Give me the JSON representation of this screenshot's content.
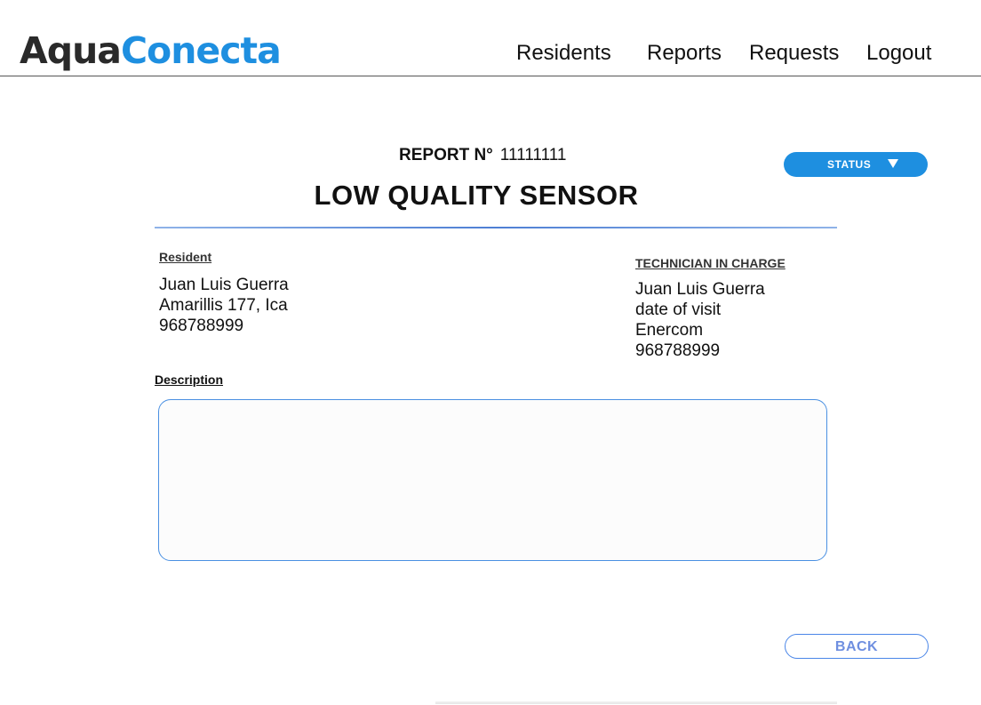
{
  "brand": {
    "name_part1": "Aqua",
    "name_part2": "Conecta",
    "color_dark": "#2a2a2a",
    "color_accent": "#1e8fe0"
  },
  "nav": {
    "residents": "Residents",
    "reports": "Reports",
    "requests": "Requests",
    "logout": "Logout"
  },
  "report": {
    "number_label": "REPORT N°",
    "number_value": "11111111",
    "title": "LOW QUALITY SENSOR"
  },
  "status": {
    "label": "STATUS",
    "icon": "triangle-down-icon"
  },
  "resident": {
    "label": "Resident",
    "name": "Juan Luis Guerra",
    "address": "Amarillis 177, Ica",
    "phone": "968788999"
  },
  "technician": {
    "label": "TECHNICIAN IN CHARGE",
    "name": "Juan Luis Guerra",
    "visit": "date of visit",
    "company": "Enercom",
    "phone": "968788999"
  },
  "description": {
    "label": "Description",
    "value": ""
  },
  "actions": {
    "back_label": "BACK"
  }
}
